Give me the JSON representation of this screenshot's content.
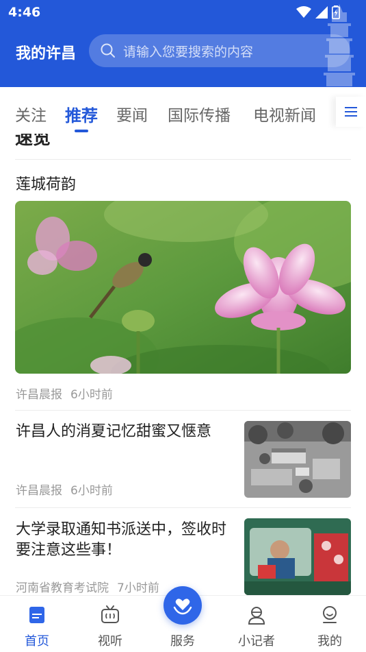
{
  "status_bar": {
    "time": "4:46"
  },
  "header": {
    "app_title": "我的许昌",
    "search_placeholder": "请输入您要搜索的内容"
  },
  "tabs": [
    {
      "label": "关注",
      "active": false
    },
    {
      "label": "推荐",
      "active": true
    },
    {
      "label": "要闻",
      "active": false
    },
    {
      "label": "国际传播",
      "active": false
    },
    {
      "label": "电视新闻",
      "active": false
    }
  ],
  "feed": {
    "cut_off_title": "速览",
    "featured": {
      "title": "莲城荷韵",
      "source": "许昌晨报",
      "time": "6小时前"
    },
    "articles": [
      {
        "title": "许昌人的消夏记忆甜蜜又惬意",
        "source": "许昌晨报",
        "time": "6小时前"
      },
      {
        "title": "大学录取通知书派送中，签收时要注意这些事！",
        "source": "河南省教育考试院",
        "time": "7小时前"
      }
    ]
  },
  "bottom_nav": [
    {
      "label": "首页",
      "active": true
    },
    {
      "label": "视听",
      "active": false
    },
    {
      "label": "服务",
      "active": false
    },
    {
      "label": "小记者",
      "active": false
    },
    {
      "label": "我的",
      "active": false
    }
  ],
  "colors": {
    "brand": "#2358d9",
    "meta_text": "#999999",
    "nav_inactive": "#555555"
  }
}
